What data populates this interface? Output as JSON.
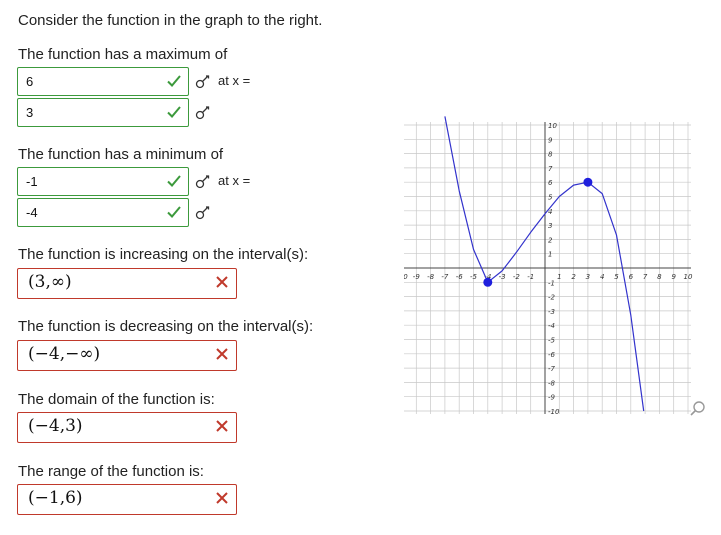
{
  "prompt": "Consider the function in the graph to the right.",
  "max_section": {
    "label": "The function has a maximum of",
    "value": "6",
    "at_label": "at x =",
    "x_value": "3"
  },
  "min_section": {
    "label": "The function has a minimum of",
    "value": "-1",
    "at_label": "at x =",
    "x_value": "-4"
  },
  "increasing": {
    "label": "The function is increasing on the interval(s):",
    "value": "(3,∞)"
  },
  "decreasing": {
    "label": "The function is decreasing on the interval(s):",
    "value": "(−4,−∞)"
  },
  "domain": {
    "label": "The domain of the function is:",
    "value": "(−4,3)"
  },
  "range": {
    "label": "The range of the function is:",
    "value": "(−1,6)"
  },
  "colors": {
    "correct": "#3c9a3c",
    "incorrect": "#c0392b",
    "curve": "#3333cc",
    "point": "#1f1fdd"
  },
  "chart_data": {
    "type": "line",
    "xlim": [
      -10,
      10
    ],
    "ylim": [
      -10,
      10
    ],
    "grid": true,
    "x_ticks": [
      "-10",
      "-9",
      "-8",
      "-7",
      "-6",
      "-5",
      "-4",
      "-3",
      "-2",
      "-1",
      "1",
      "2",
      "3",
      "4",
      "5",
      "6",
      "7",
      "8",
      "9",
      "10"
    ],
    "y_ticks": [
      "10",
      "9",
      "8",
      "7",
      "6",
      "5",
      "4",
      "3",
      "2",
      "1",
      "-1",
      "-2",
      "-3",
      "-4",
      "-5",
      "-6",
      "-7",
      "-8",
      "-9",
      "-10"
    ],
    "series": [
      {
        "x": [
          -7,
          -6,
          -5,
          -4,
          -3,
          -2,
          -1,
          0,
          1,
          2,
          3,
          4,
          5,
          6,
          6.9
        ],
        "y": [
          10.6,
          5.4,
          1.3,
          -1,
          -0.2,
          1.1,
          2.5,
          3.8,
          5.0,
          5.8,
          6.0,
          5.2,
          2.3,
          -3.3,
          -10
        ]
      }
    ],
    "points": [
      {
        "x": -4,
        "y": -1
      },
      {
        "x": 3,
        "y": 6
      }
    ]
  }
}
